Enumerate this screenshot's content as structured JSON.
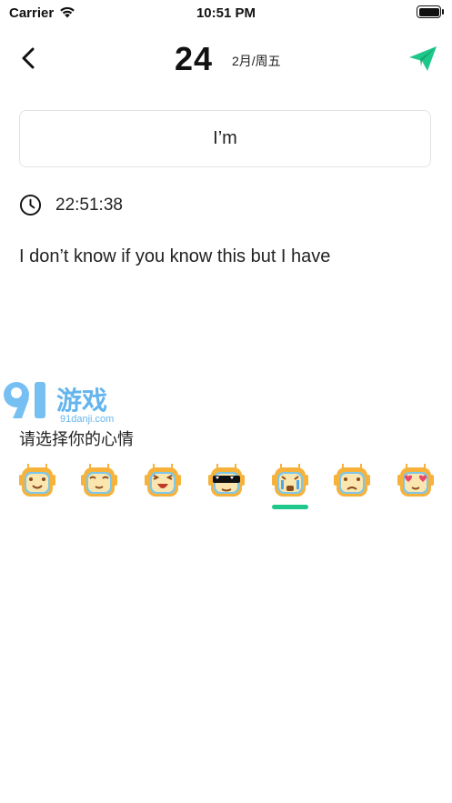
{
  "status_bar": {
    "carrier": "Carrier",
    "time": "10:51 PM"
  },
  "header": {
    "day": "24",
    "date_sub": "2月/周五"
  },
  "entry": {
    "title_value": "I’m",
    "time": "22:51:38",
    "body": "I don’t know if you know this but I have"
  },
  "watermark": {
    "main": "游戏",
    "sub": "91danji.com"
  },
  "mood": {
    "label": "请选择你的心情",
    "selected_index": 4,
    "items": [
      "smile-robot-icon",
      "content-robot-icon",
      "laugh-robot-icon",
      "cool-robot-icon",
      "cry-robot-icon",
      "sad-robot-icon",
      "love-robot-icon"
    ]
  },
  "colors": {
    "accent": "#1dc88a",
    "robot": "#f6b23a",
    "robot_face": "#7fc7e8"
  }
}
